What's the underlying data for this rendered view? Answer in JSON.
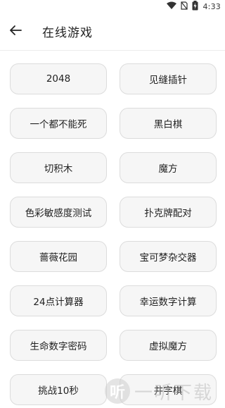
{
  "status_bar": {
    "time": "4:33",
    "icons": [
      "wifi-icon",
      "no-sim-icon",
      "battery-charging-icon"
    ]
  },
  "header": {
    "back_icon": "arrow-left-icon",
    "title": "在线游戏"
  },
  "games": [
    "2048",
    "见缝插针",
    "一个都不能死",
    "黑白棋",
    "切积木",
    "魔方",
    "色彩敏感度测试",
    "扑克牌配对",
    "蔷薇花园",
    "宝可梦杂交器",
    "24点计算器",
    "幸运数字计算",
    "生命数字密码",
    "虚拟魔方",
    "挑战10秒",
    "井字棋"
  ],
  "watermark": {
    "logo_char": "听",
    "text": "一听下载"
  }
}
